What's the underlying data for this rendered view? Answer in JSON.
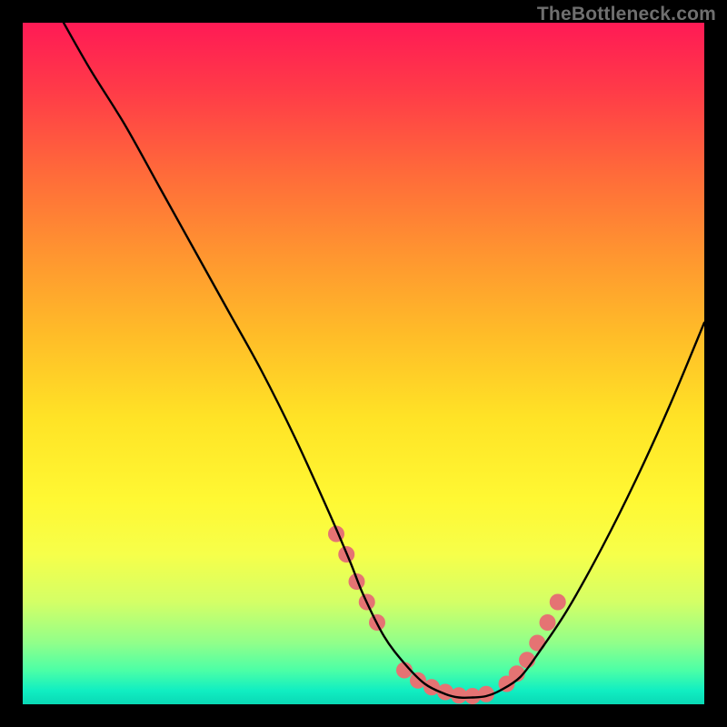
{
  "watermark": "TheBottleneck.com",
  "chart_data": {
    "type": "line",
    "title": "",
    "xlabel": "",
    "ylabel": "",
    "xlim": [
      0,
      100
    ],
    "ylim": [
      0,
      100
    ],
    "grid": false,
    "legend": false,
    "series": [
      {
        "name": "curve",
        "color": "#000000",
        "x": [
          6,
          10,
          15,
          20,
          25,
          30,
          35,
          40,
          45,
          48,
          50,
          53,
          56,
          59,
          62,
          64,
          66,
          68,
          70,
          73,
          76,
          80,
          85,
          90,
          95,
          100
        ],
        "y": [
          100,
          93,
          85,
          76,
          67,
          58,
          49,
          39,
          28,
          21,
          16,
          10,
          6,
          3,
          1.5,
          1,
          1,
          1.2,
          2,
          4,
          8,
          14,
          23,
          33,
          44,
          56
        ]
      }
    ],
    "markers": {
      "name": "highlight-dots",
      "color": "#e57373",
      "radius_px": 9,
      "x": [
        46,
        47.5,
        49,
        50.5,
        52,
        56,
        58,
        60,
        62,
        64,
        66,
        68,
        71,
        72.5,
        74,
        75.5,
        77,
        78.5
      ],
      "y": [
        25,
        22,
        18,
        15,
        12,
        5,
        3.5,
        2.5,
        1.8,
        1.3,
        1.2,
        1.5,
        3,
        4.5,
        6.5,
        9,
        12,
        15
      ]
    }
  }
}
